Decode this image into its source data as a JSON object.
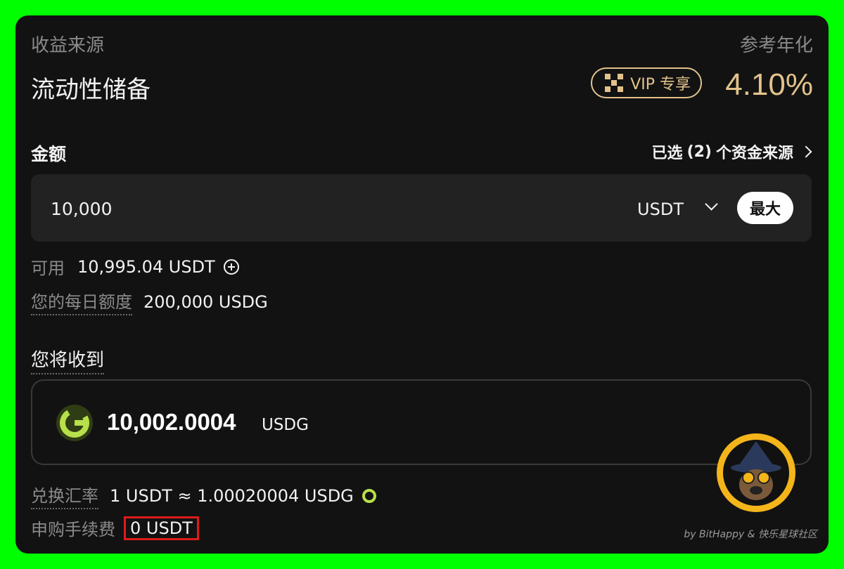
{
  "header": {
    "source_label": "收益来源",
    "apr_label": "参考年化",
    "product_name": "流动性储备",
    "vip_badge": "VIP 专享",
    "apr_value": "4.10%"
  },
  "amount": {
    "label": "金额",
    "sources_text_prefix": "已选",
    "sources_count": "(2)",
    "sources_text_suffix": "个资金来源",
    "input_value": "10,000",
    "currency": "USDT",
    "max_button": "最大"
  },
  "balances": {
    "available_label": "可用",
    "available_value": "10,995.04 USDT",
    "quota_label": "您的每日额度",
    "quota_value": "200,000 USDG"
  },
  "receive": {
    "label": "您将收到",
    "amount": "10,002.0004",
    "unit": "USDG"
  },
  "details": {
    "rate_label": "兑换汇率",
    "rate_value": "1 USDT ≈ 1.00020004 USDG",
    "fee_label": "申购手续费",
    "fee_value": "0 USDT"
  },
  "watermark": "by BitHappy & 快乐星球社区",
  "colors": {
    "background": "#00ff00",
    "card": "#121212",
    "gold": "#e2c28b",
    "ring": "#b8e04a",
    "highlight": "#e01b1b"
  }
}
